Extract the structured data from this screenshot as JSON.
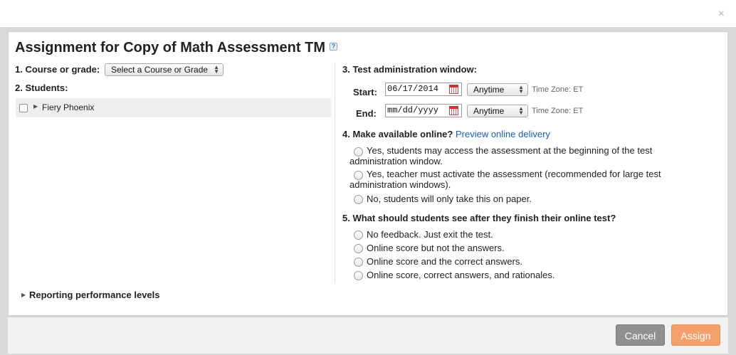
{
  "close_label": "×",
  "dialog": {
    "title": "Assignment for Copy of Math Assessment TM",
    "help_icon": "?"
  },
  "left": {
    "course_label": "1. Course or grade:",
    "course_select": "Select a Course or Grade",
    "students_label": "2. Students:",
    "students": [
      {
        "name": "Fiery Phoenix",
        "checked": false
      }
    ]
  },
  "right": {
    "window_label": "3. Test administration window:",
    "start_label": "Start:",
    "start_value": "06/17/2014",
    "start_time": "Anytime",
    "end_label": "End:",
    "end_value": "mm/dd/yyyy",
    "end_time": "Anytime",
    "timezone": "Time Zone: ET",
    "online_label": "4. Make available online?",
    "preview_link": "Preview online delivery",
    "online_options": [
      "Yes, students may access the assessment at the beginning of the test administration window.",
      "Yes, teacher must activate the assessment (recommended for large test administration windows).",
      "No, students will only take this on paper."
    ],
    "feedback_label": "5. What should students see after they finish their online test?",
    "feedback_options": [
      "No feedback. Just exit the test.",
      "Online score but not the answers.",
      "Online score and the correct answers.",
      "Online score, correct answers, and rationales."
    ]
  },
  "reporting_label": "Reporting performance levels",
  "footer": {
    "cancel_label": "Cancel",
    "assign_label": "Assign"
  },
  "colors": {
    "assign_button": "#f3a06d",
    "cancel_button": "#909090",
    "link": "#1a5fb4"
  }
}
